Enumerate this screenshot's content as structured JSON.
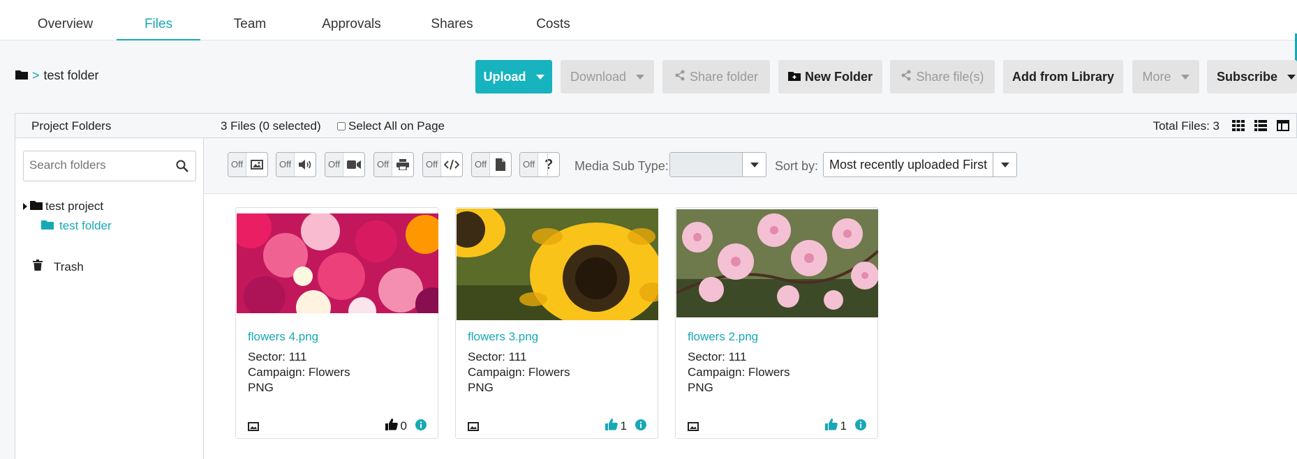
{
  "tabs": [
    "Overview",
    "Files",
    "Team",
    "Approvals",
    "Shares",
    "Costs"
  ],
  "breadcrumb": {
    "separator": ">",
    "folder": "test folder"
  },
  "toolbar": {
    "upload": "Upload",
    "download": "Download",
    "share_folder": "Share folder",
    "new_folder": "New Folder",
    "share_files": "Share file(s)",
    "add_from_library": "Add from Library",
    "more": "More",
    "subscribe": "Subscribe"
  },
  "panel": {
    "title": "Project Folders",
    "file_count": "3 Files (0 selected)",
    "select_all": "Select All on Page",
    "total": "Total Files: 3"
  },
  "sidebar": {
    "search_placeholder": "Search folders",
    "project": "test project",
    "folder": "test folder",
    "trash": "Trash"
  },
  "filters": {
    "off_label": "Off",
    "toggles": [
      "image-icon",
      "audio-icon",
      "video-icon",
      "print-icon",
      "code-icon",
      "document-icon",
      "question-icon"
    ],
    "media_sub_type_label": "Media Sub Type:",
    "media_sub_type_value": "",
    "sort_label": "Sort by:",
    "sort_value": "Most recently uploaded First"
  },
  "files": [
    {
      "name": "flowers 4.png",
      "sector": "Sector: 111",
      "campaign": "Campaign: Flowers",
      "type": "PNG",
      "likes": "0",
      "liked": false
    },
    {
      "name": "flowers 3.png",
      "sector": "Sector: 111",
      "campaign": "Campaign: Flowers",
      "type": "PNG",
      "likes": "1",
      "liked": true
    },
    {
      "name": "flowers 2.png",
      "sector": "Sector: 111",
      "campaign": "Campaign: Flowers",
      "type": "PNG",
      "likes": "1",
      "liked": true
    }
  ],
  "colors": {
    "accent": "#17a8b6",
    "primary_button": "#17b3bf"
  }
}
